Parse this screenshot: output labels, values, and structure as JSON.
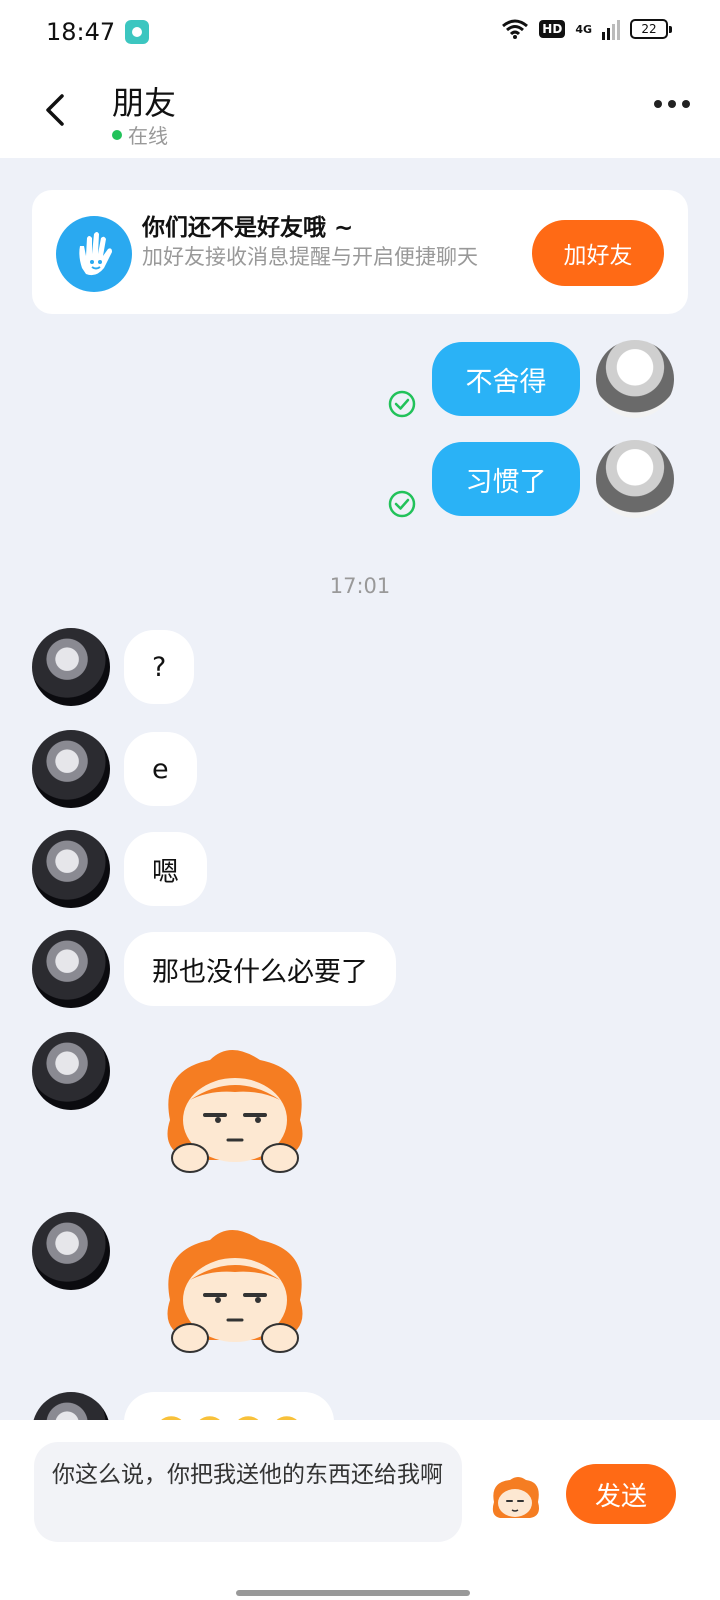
{
  "status_bar": {
    "time": "18:47",
    "hd": "HD",
    "network": "4G",
    "battery": "22"
  },
  "header": {
    "title": "朋友",
    "status": "在线"
  },
  "friend_card": {
    "title": "你们还不是好友哦 ~",
    "description": "加好友接收消息提醒与开启便捷聊天",
    "button": "加好友"
  },
  "messages": {
    "out": [
      {
        "text": "不舍得"
      },
      {
        "text": "习惯了"
      }
    ],
    "timestamp": "17:01",
    "in": [
      {
        "text": "?"
      },
      {
        "text": "e"
      },
      {
        "text": "嗯"
      },
      {
        "text": "那也没什么必要了"
      }
    ]
  },
  "input": {
    "value": "你这么说，你把我送他的东西还给我啊",
    "send_label": "发送"
  },
  "colors": {
    "accent_orange": "#ff6a15",
    "bubble_blue": "#2ab2f6",
    "online_green": "#22c25a"
  }
}
